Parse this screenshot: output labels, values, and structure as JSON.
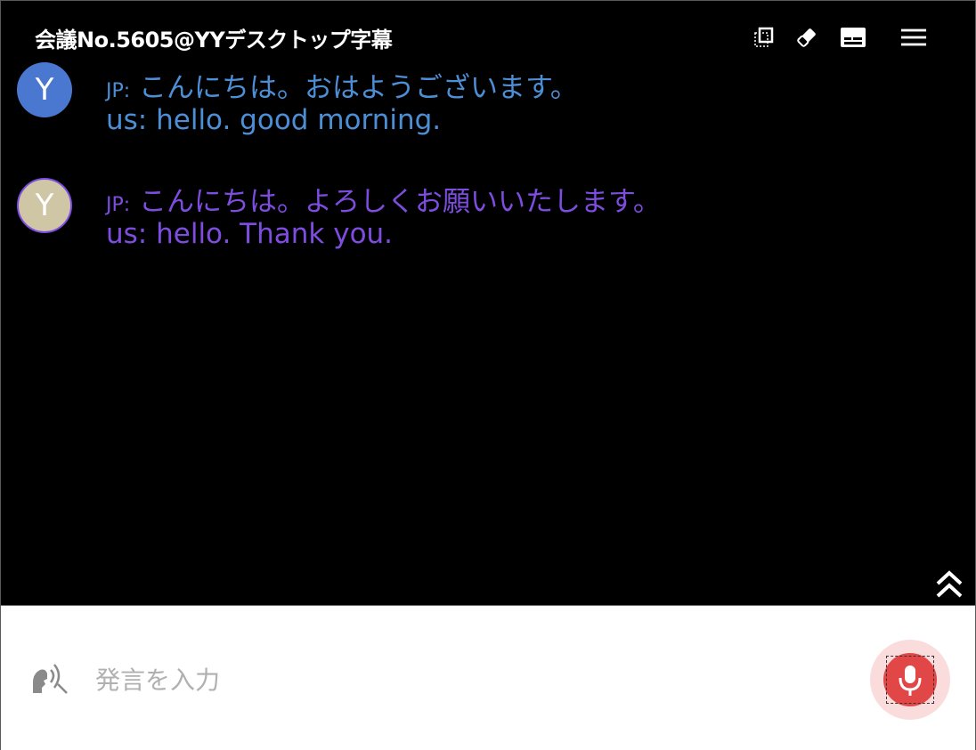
{
  "window": {
    "title": "会議No.5605@YYデスクトップ字幕"
  },
  "toolbar": {
    "icons": [
      "copy-window-icon",
      "eraser-icon",
      "subtitles-icon",
      "menu-icon"
    ]
  },
  "messages": [
    {
      "avatar_letter": "Y",
      "avatar_color": "#4a78d0",
      "text_color": "#4d8fd6",
      "jp_tag": "JP:",
      "jp_text": "こんにちは。おはようございます。",
      "us_tag": "us:",
      "us_text": "hello. good morning."
    },
    {
      "avatar_letter": "Y",
      "avatar_color": "#cfc6a6",
      "text_color": "#7e4de0",
      "jp_tag": "JP:",
      "jp_text": "こんにちは。よろしくお願いいたします。",
      "us_tag": "us:",
      "us_text": "hello. Thank you."
    }
  ],
  "input": {
    "placeholder": "発言を入力",
    "value": ""
  },
  "colors": {
    "background": "#000000",
    "mic_accent": "#e24747",
    "mic_halo": "#fbdcdc"
  }
}
